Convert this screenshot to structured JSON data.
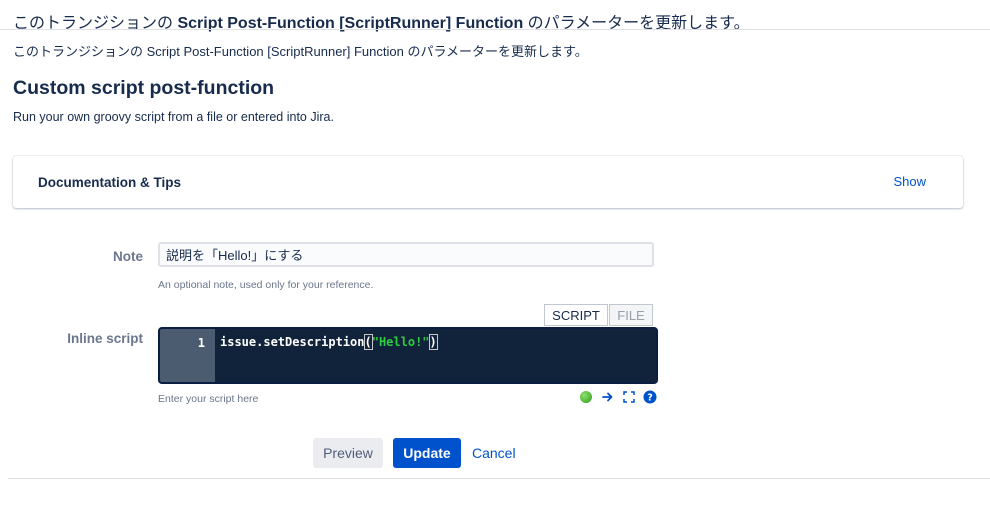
{
  "header": {
    "title_prefix": "このトランジションの ",
    "title_bold": "Script Post-Function [ScriptRunner] Function",
    "title_suffix": " のパラメーターを更新します。",
    "subtitle": "このトランジションの Script Post-Function [ScriptRunner] Function のパラメーターを更新します。"
  },
  "section": {
    "title": "Custom script post-function",
    "description": "Run your own groovy script from a file or entered into Jira."
  },
  "doc_panel": {
    "label": "Documentation & Tips",
    "toggle": "Show"
  },
  "note": {
    "label": "Note",
    "value": "説明を「Hello!」にする",
    "help": "An optional note, used only for your reference."
  },
  "script": {
    "label": "Inline script",
    "tabs": [
      "SCRIPT",
      "FILE"
    ],
    "active_tab": "SCRIPT",
    "line_number": "1",
    "code_before": "issue.setDescription",
    "code_open": "(",
    "code_string": "\"Hello!\"",
    "code_close": ")",
    "help": "Enter your script here",
    "toolbar_icons": [
      "status-ok-icon",
      "arrow-right-icon",
      "fullscreen-icon",
      "help-icon"
    ]
  },
  "actions": {
    "preview": "Preview",
    "update": "Update",
    "cancel": "Cancel"
  },
  "colors": {
    "primary": "#0052cc",
    "editor_bg": "#11233a",
    "string": "#2ecc40"
  }
}
